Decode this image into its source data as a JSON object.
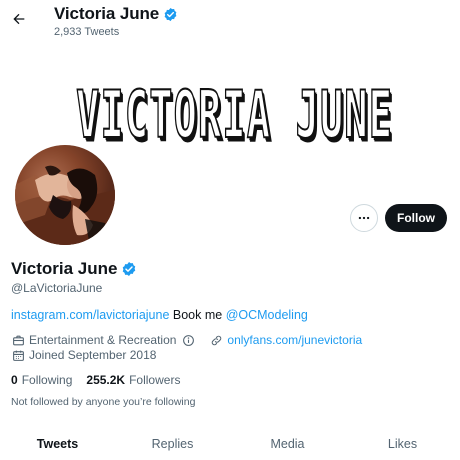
{
  "header": {
    "name": "Victoria June",
    "tweet_count": "2,933 Tweets"
  },
  "banner": {
    "text": "VICTORIA JUNE"
  },
  "profile": {
    "name": "Victoria June",
    "handle": "@LaVictoriaJune",
    "verified": true,
    "verified_color": "#1d9bf0"
  },
  "actions": {
    "more_icon": "more-horizontal-icon",
    "follow_label": "Follow"
  },
  "bio": {
    "link1": "instagram.com/lavictoriajune",
    "text": " Book me ",
    "mention": "@OCModeling"
  },
  "meta": {
    "category": "Entertainment & Recreation",
    "website": "onlyfans.com/junevictoria",
    "joined": "Joined September 2018"
  },
  "stats": {
    "following_count": "0",
    "following_label": "Following",
    "followers_count": "255.2K",
    "followers_label": "Followers"
  },
  "not_followed_text": "Not followed by anyone you’re following",
  "tabs": [
    {
      "label": "Tweets",
      "active": true
    },
    {
      "label": "Replies",
      "active": false
    },
    {
      "label": "Media",
      "active": false
    },
    {
      "label": "Likes",
      "active": false
    }
  ],
  "colors": {
    "link": "#1d9bf0",
    "text": "#0f1419",
    "secondary": "#536471"
  }
}
